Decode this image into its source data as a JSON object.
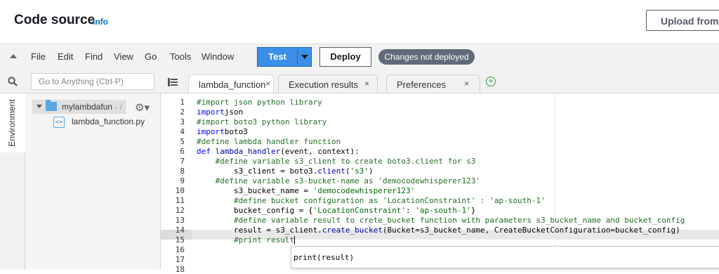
{
  "header": {
    "title": "Code source",
    "info_link": "Info",
    "upload_button": "Upload from"
  },
  "menubar": {
    "items": [
      "File",
      "Edit",
      "Find",
      "View",
      "Go",
      "Tools",
      "Window"
    ],
    "test_button": "Test",
    "deploy_button": "Deploy",
    "status_badge": "Changes not deployed"
  },
  "search": {
    "placeholder": "Go to Anything (Ctrl-P)"
  },
  "tabs": [
    {
      "label": "lambda_function",
      "close": "×",
      "active": true
    },
    {
      "label": "Execution results",
      "close": "×",
      "active": false
    },
    {
      "label": "Preferences",
      "close": "×",
      "active": false
    }
  ],
  "sidebar": {
    "environment_label": "Environment",
    "root_folder": "mylambdafun",
    "root_suffix": " - /",
    "file": "lambda_function.py"
  },
  "editor": {
    "line_numbers": [
      "1",
      "2",
      "3",
      "4",
      "5",
      "6",
      "7",
      "8",
      "9",
      "10",
      "11",
      "12",
      "13",
      "14",
      "15",
      "16",
      "17",
      "18"
    ],
    "active_line": "15"
  },
  "autocomplete": {
    "suggestion": "print(result)"
  },
  "colors": {
    "test_button": "#3c8fe8",
    "badge": "#5f6b7a",
    "comment": "#236e24",
    "keyword": "#0000ff",
    "string": "#036a07"
  }
}
